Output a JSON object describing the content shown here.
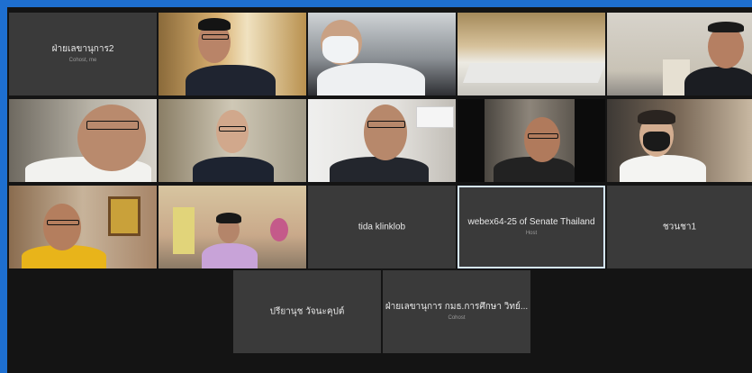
{
  "meeting": {
    "participants": [
      {
        "id": "p1",
        "name": "ฝ่ายเลขานุการ2",
        "role": "Cohost, me",
        "has_video": false
      },
      {
        "id": "p2",
        "name": "",
        "role": "",
        "has_video": true
      },
      {
        "id": "p3",
        "name": "",
        "role": "",
        "has_video": true
      },
      {
        "id": "p4",
        "name": "",
        "role": "",
        "has_video": true
      },
      {
        "id": "p5",
        "name": "",
        "role": "",
        "has_video": true
      },
      {
        "id": "p6",
        "name": "",
        "role": "",
        "has_video": true
      },
      {
        "id": "p7",
        "name": "",
        "role": "",
        "has_video": true
      },
      {
        "id": "p8",
        "name": "",
        "role": "",
        "has_video": true
      },
      {
        "id": "p9",
        "name": "",
        "role": "",
        "has_video": true
      },
      {
        "id": "p10",
        "name": "",
        "role": "",
        "has_video": true
      },
      {
        "id": "p11",
        "name": "",
        "role": "",
        "has_video": true
      },
      {
        "id": "p12",
        "name": "",
        "role": "",
        "has_video": true
      },
      {
        "id": "p13",
        "name": "tida klinklob",
        "role": "",
        "has_video": false
      },
      {
        "id": "p14",
        "name": "webex64-25 of Senate Thailand",
        "role": "Host",
        "has_video": false
      },
      {
        "id": "p15",
        "name": "ชวนชา1",
        "role": "",
        "has_video": false
      },
      {
        "id": "p16",
        "name": "ปรียานุช วัจนะคุปต์",
        "role": "",
        "has_video": false
      },
      {
        "id": "p17",
        "name": "ฝ่ายเลขานุการ กมธ.การศึกษา วิทย์...",
        "role": "Cohost",
        "has_video": false
      }
    ]
  },
  "colors": {
    "frame": "#1e6fd0",
    "stage": "#141414",
    "tile": "#3a3a3a"
  }
}
